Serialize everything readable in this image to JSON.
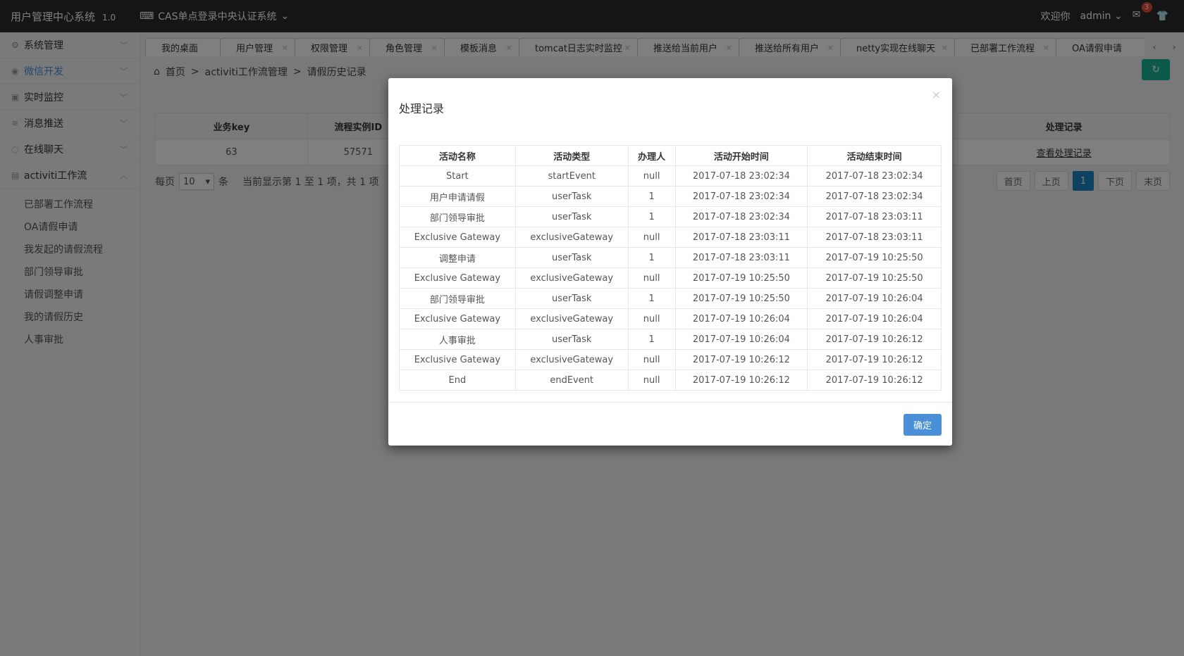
{
  "app": {
    "title": "用户管理中心系统",
    "version": "1.0",
    "system_switch": "CAS单点登录中央认证系统"
  },
  "user": {
    "welcome": "欢迎你",
    "name": "admin",
    "mail_count": "3"
  },
  "sidebar": {
    "items": [
      {
        "label": "系统管理",
        "icon": "gear-icon"
      },
      {
        "label": "微信开发",
        "icon": "wechat-icon"
      },
      {
        "label": "实时监控",
        "icon": "monitor-icon"
      },
      {
        "label": "消息推送",
        "icon": "rss-icon"
      },
      {
        "label": "在线聊天",
        "icon": "chat-icon"
      },
      {
        "label": "activiti工作流",
        "icon": "workflow-icon"
      }
    ],
    "subitems": [
      "已部署工作流程",
      "OA请假申请",
      "我发起的请假流程",
      "部门领导审批",
      "请假调整申请",
      "我的请假历史",
      "人事审批"
    ]
  },
  "tabs": [
    "我的桌面",
    "用户管理",
    "权限管理",
    "角色管理",
    "模板消息",
    "tomcat日志实时监控",
    "推送给当前用户",
    "推送给所有用户",
    "netty实现在线聊天",
    "已部署工作流程",
    "OA请假申请"
  ],
  "breadcrumb": {
    "home": "首页",
    "sep": ">",
    "level1": "activiti工作流管理",
    "level2": "请假历史记录"
  },
  "main_table": {
    "headers": [
      "业务key",
      "流程实例ID",
      "处理记录"
    ],
    "row": [
      "63",
      "57571",
      "查看处理记录"
    ]
  },
  "pager": {
    "per_page_label": "每页",
    "per_page_value": "10",
    "unit": "条",
    "summary": "当前显示第 1 至 1 项，共 1 项",
    "first": "首页",
    "prev": "上页",
    "current": "1",
    "next": "下页",
    "last": "末页"
  },
  "modal": {
    "title": "处理记录",
    "close": "×",
    "ok": "确定",
    "headers": [
      "活动名称",
      "活动类型",
      "办理人",
      "活动开始时间",
      "活动结束时间"
    ],
    "rows": [
      [
        "Start",
        "startEvent",
        "null",
        "2017-07-18 23:02:34",
        "2017-07-18 23:02:34"
      ],
      [
        "用户申请请假",
        "userTask",
        "1",
        "2017-07-18 23:02:34",
        "2017-07-18 23:02:34"
      ],
      [
        "部门领导审批",
        "userTask",
        "1",
        "2017-07-18 23:02:34",
        "2017-07-18 23:03:11"
      ],
      [
        "Exclusive Gateway",
        "exclusiveGateway",
        "null",
        "2017-07-18 23:03:11",
        "2017-07-18 23:03:11"
      ],
      [
        "调整申请",
        "userTask",
        "1",
        "2017-07-18 23:03:11",
        "2017-07-19 10:25:50"
      ],
      [
        "Exclusive Gateway",
        "exclusiveGateway",
        "null",
        "2017-07-19 10:25:50",
        "2017-07-19 10:25:50"
      ],
      [
        "部门领导审批",
        "userTask",
        "1",
        "2017-07-19 10:25:50",
        "2017-07-19 10:26:04"
      ],
      [
        "Exclusive Gateway",
        "exclusiveGateway",
        "null",
        "2017-07-19 10:26:04",
        "2017-07-19 10:26:04"
      ],
      [
        "人事审批",
        "userTask",
        "1",
        "2017-07-19 10:26:04",
        "2017-07-19 10:26:12"
      ],
      [
        "Exclusive Gateway",
        "exclusiveGateway",
        "null",
        "2017-07-19 10:26:12",
        "2017-07-19 10:26:12"
      ],
      [
        "End",
        "endEvent",
        "null",
        "2017-07-19 10:26:12",
        "2017-07-19 10:26:12"
      ]
    ]
  }
}
